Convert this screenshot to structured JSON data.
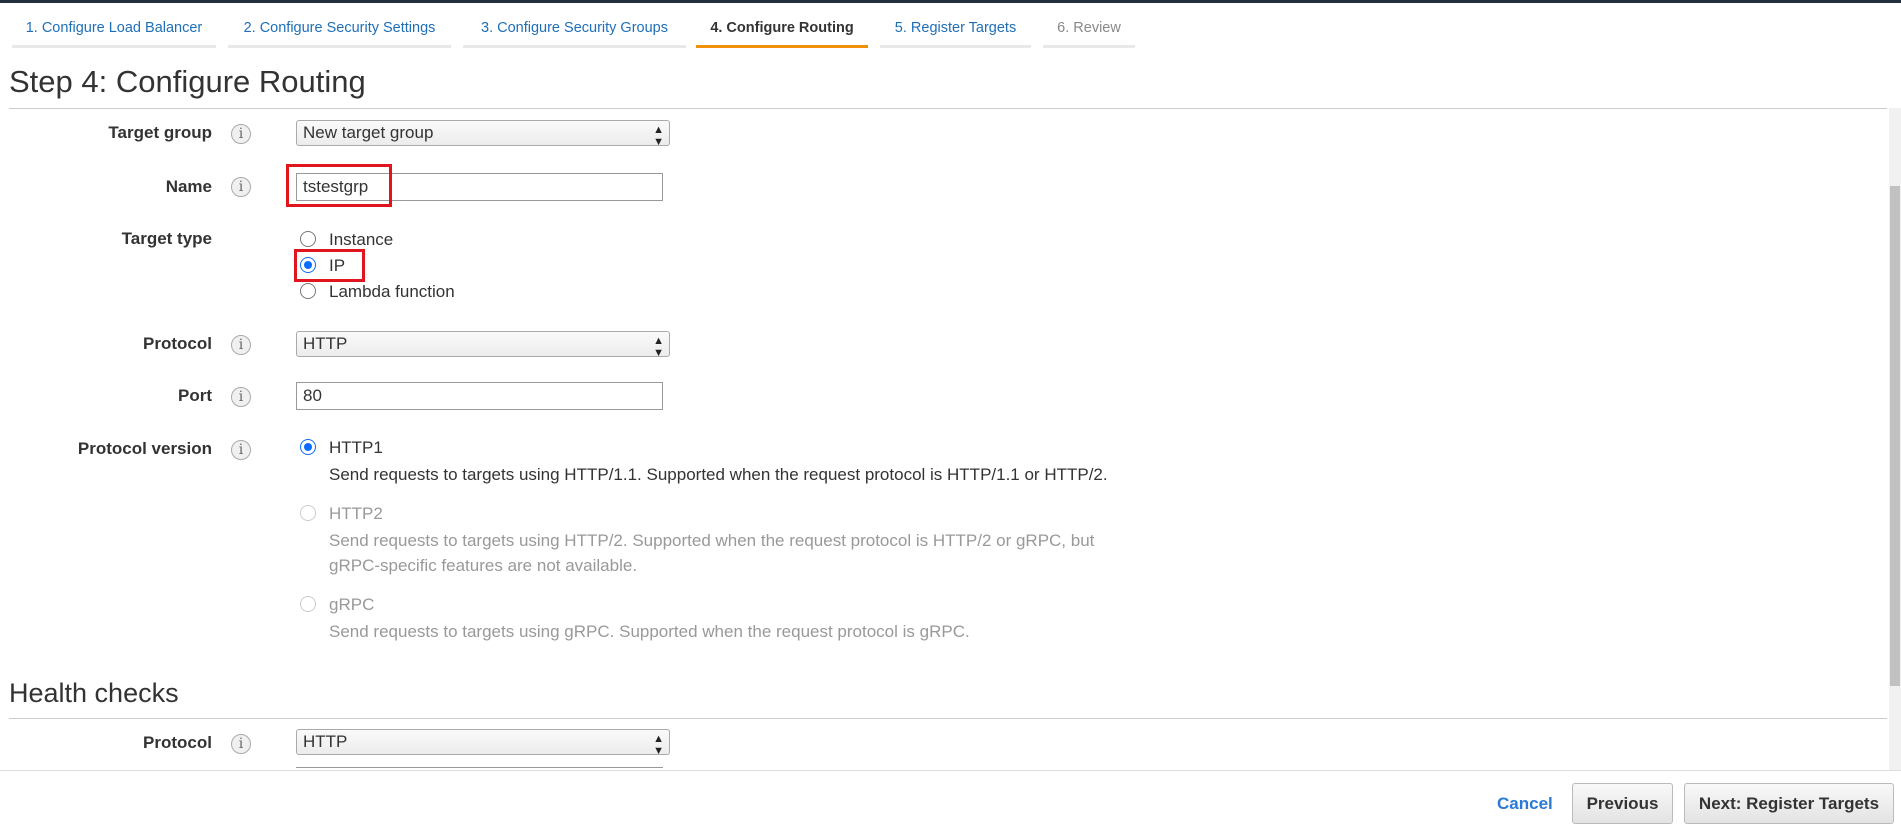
{
  "wizard": {
    "tabs": [
      {
        "label": "1. Configure Load Balancer",
        "state": "link"
      },
      {
        "label": "2. Configure Security Settings",
        "state": "link"
      },
      {
        "label": "3. Configure Security Groups",
        "state": "link"
      },
      {
        "label": "4. Configure Routing",
        "state": "active"
      },
      {
        "label": "5. Register Targets",
        "state": "link"
      },
      {
        "label": "6. Review",
        "state": "disabled"
      }
    ],
    "title": "Step 4: Configure Routing"
  },
  "routing": {
    "target_group": {
      "label": "Target group",
      "value": "New target group"
    },
    "name": {
      "label": "Name",
      "value": "tstestgrp"
    },
    "target_type": {
      "label": "Target type",
      "options": [
        "Instance",
        "IP",
        "Lambda function"
      ],
      "selected": "IP"
    },
    "protocol": {
      "label": "Protocol",
      "value": "HTTP"
    },
    "port": {
      "label": "Port",
      "value": "80"
    },
    "protocol_version": {
      "label": "Protocol version",
      "options": [
        {
          "label": "HTTP1",
          "desc": [
            "Send requests to targets using HTTP/1.1. Supported when the request protocol is HTTP/1.1 or HTTP/2."
          ],
          "enabled": true,
          "selected": true
        },
        {
          "label": "HTTP2",
          "desc": [
            "Send requests to targets using HTTP/2. Supported when the request protocol is HTTP/2 or gRPC, but",
            "gRPC-specific features are not available."
          ],
          "enabled": false
        },
        {
          "label": "gRPC",
          "desc": [
            "Send requests to targets using gRPC. Supported when the request protocol is gRPC."
          ],
          "enabled": false
        }
      ]
    }
  },
  "health_checks": {
    "title": "Health checks",
    "protocol": {
      "label": "Protocol",
      "value": "HTTP"
    }
  },
  "footer": {
    "cancel": "Cancel",
    "previous": "Previous",
    "next": "Next: Register Targets"
  },
  "colors": {
    "accent": "#f0900b",
    "link": "#1f6fb8",
    "highlight": "#e0151d",
    "radio": "#0a6cff"
  }
}
